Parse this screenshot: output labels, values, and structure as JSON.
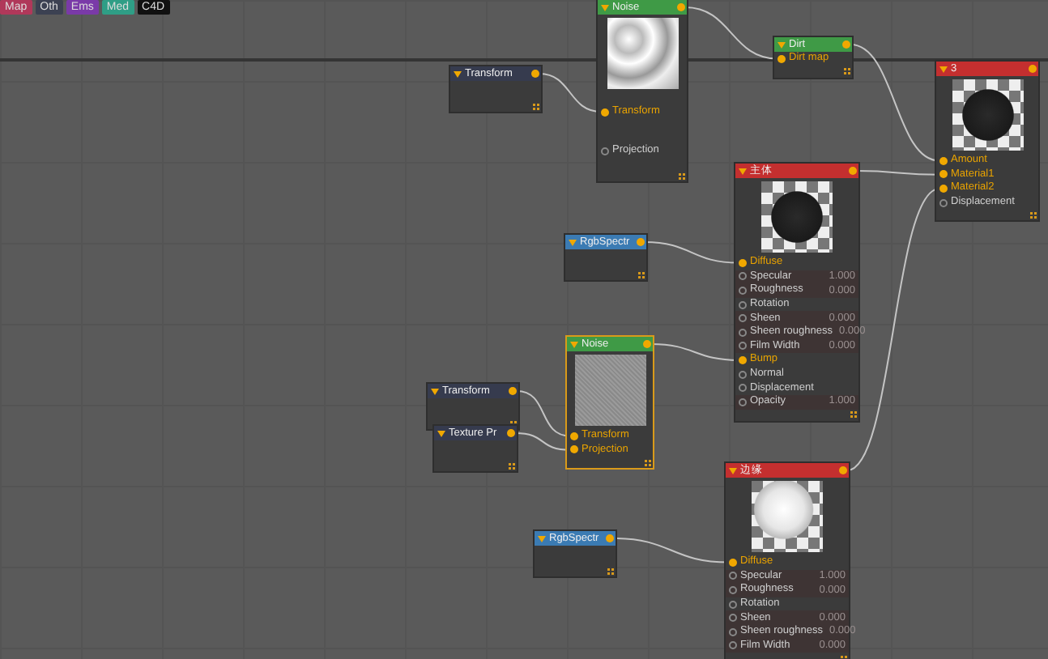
{
  "tabs": [
    {
      "label": "Map",
      "color": "#b0385a"
    },
    {
      "label": "Oth",
      "color": "#3c4152"
    },
    {
      "label": "Ems",
      "color": "#7a3aa8"
    },
    {
      "label": "Med",
      "color": "#2f9e86"
    },
    {
      "label": "C4D",
      "color": "#111111"
    }
  ],
  "nodes": [
    {
      "title": "Transform",
      "kind": "transform",
      "selected": false
    },
    {
      "title": "Noise",
      "kind": "texture",
      "selected": false,
      "preview": {
        "kind": "clouds"
      },
      "ports": [
        {
          "label": "Transform",
          "connected": true
        },
        {
          "label": "Projection",
          "connected": false
        }
      ]
    },
    {
      "title": "Dirt",
      "kind": "texture",
      "selected": false,
      "ports": [
        {
          "label": "Dirt map",
          "connected": true
        }
      ]
    },
    {
      "title": "3",
      "kind": "material",
      "selected": false,
      "preview": {
        "kind": "dark-sphere"
      },
      "ports": [
        {
          "label": "Amount",
          "connected": true
        },
        {
          "label": "Material1",
          "connected": true
        },
        {
          "label": "Material2",
          "connected": true
        },
        {
          "label": "Displacement",
          "connected": false
        }
      ]
    },
    {
      "title": "主体",
      "kind": "material",
      "selected": false,
      "preview": {
        "kind": "dark-sphere"
      },
      "ports": [
        {
          "label": "Diffuse",
          "connected": true
        },
        {
          "label": "Specular",
          "connected": false,
          "value": "1.000"
        },
        {
          "label": "Roughness",
          "connected": false,
          "value": "0.000"
        },
        {
          "label": "Rotation",
          "connected": false
        },
        {
          "label": "Sheen",
          "connected": false,
          "value": "0.000"
        },
        {
          "label": "Sheen roughness",
          "connected": false,
          "value": "0.000"
        },
        {
          "label": "Film Width",
          "connected": false,
          "value": "0.000"
        },
        {
          "label": "Bump",
          "connected": true
        },
        {
          "label": "Normal",
          "connected": false
        },
        {
          "label": "Displacement",
          "connected": false
        },
        {
          "label": "Opacity",
          "connected": false,
          "value": "1.000"
        }
      ]
    },
    {
      "title": "RgbSpectr",
      "kind": "color",
      "selected": false
    },
    {
      "title": "Noise",
      "kind": "texture",
      "selected": true,
      "preview": {
        "kind": "noise"
      },
      "ports": [
        {
          "label": "Transform",
          "connected": true
        },
        {
          "label": "Projection",
          "connected": true
        }
      ]
    },
    {
      "title": "Transform",
      "kind": "transform",
      "selected": false
    },
    {
      "title": "Texture Pr",
      "kind": "transform",
      "selected": false
    },
    {
      "title": "RgbSpectr",
      "kind": "color",
      "selected": false
    },
    {
      "title": "边缘",
      "kind": "material",
      "selected": false,
      "preview": {
        "kind": "white-sphere"
      },
      "ports": [
        {
          "label": "Diffuse",
          "connected": true
        },
        {
          "label": "Specular",
          "connected": false,
          "value": "1.000"
        },
        {
          "label": "Roughness",
          "connected": false,
          "value": "0.000"
        },
        {
          "label": "Rotation",
          "connected": false
        },
        {
          "label": "Sheen",
          "connected": false,
          "value": "0.000"
        },
        {
          "label": "Sheen roughness",
          "connected": false,
          "value": "0.000"
        },
        {
          "label": "Film Width",
          "connected": false,
          "value": "0.000"
        }
      ]
    }
  ]
}
